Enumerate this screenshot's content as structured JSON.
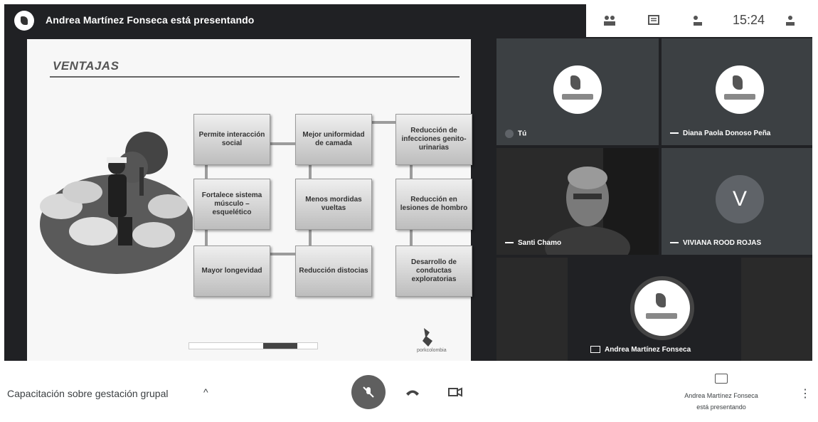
{
  "presentation_bar": {
    "title": "Andrea Martínez Fonseca está presentando",
    "time": "15:24"
  },
  "slide": {
    "title": "VENTAJAS",
    "boxes": [
      "Permite interacción social",
      "Mejor uniformidad de camada",
      "Reducción de infecciones genito-urinarias",
      "Fortalece sistema músculo – esquelético",
      "Menos mordidas vueltas",
      "Reducción en lesiones de hombro",
      "Mayor longevidad",
      "Reducción distocias",
      "Desarrollo de conductas exploratorias"
    ],
    "logo_text": "porkcolombia"
  },
  "participants": [
    {
      "name": "Tú"
    },
    {
      "name": "Diana Paola Donoso Peña"
    },
    {
      "name": "Santi Chamo"
    },
    {
      "name": "VIVIANA ROOD ROJAS",
      "initial": "V"
    },
    {
      "name": "Andrea Martínez Fonseca"
    }
  ],
  "bottom_bar": {
    "meeting_name": "Capacitación sobre gestación grupal",
    "chevron": "^",
    "presenting_line1": "Andrea Martínez Fonseca",
    "presenting_line2": "está presentando",
    "more": "⋮"
  },
  "icons": [
    "people-icon",
    "chat-icon",
    "activities-icon",
    "mic-off-icon",
    "hang-up-icon",
    "camera-icon",
    "present-icon",
    "more-options-icon"
  ]
}
